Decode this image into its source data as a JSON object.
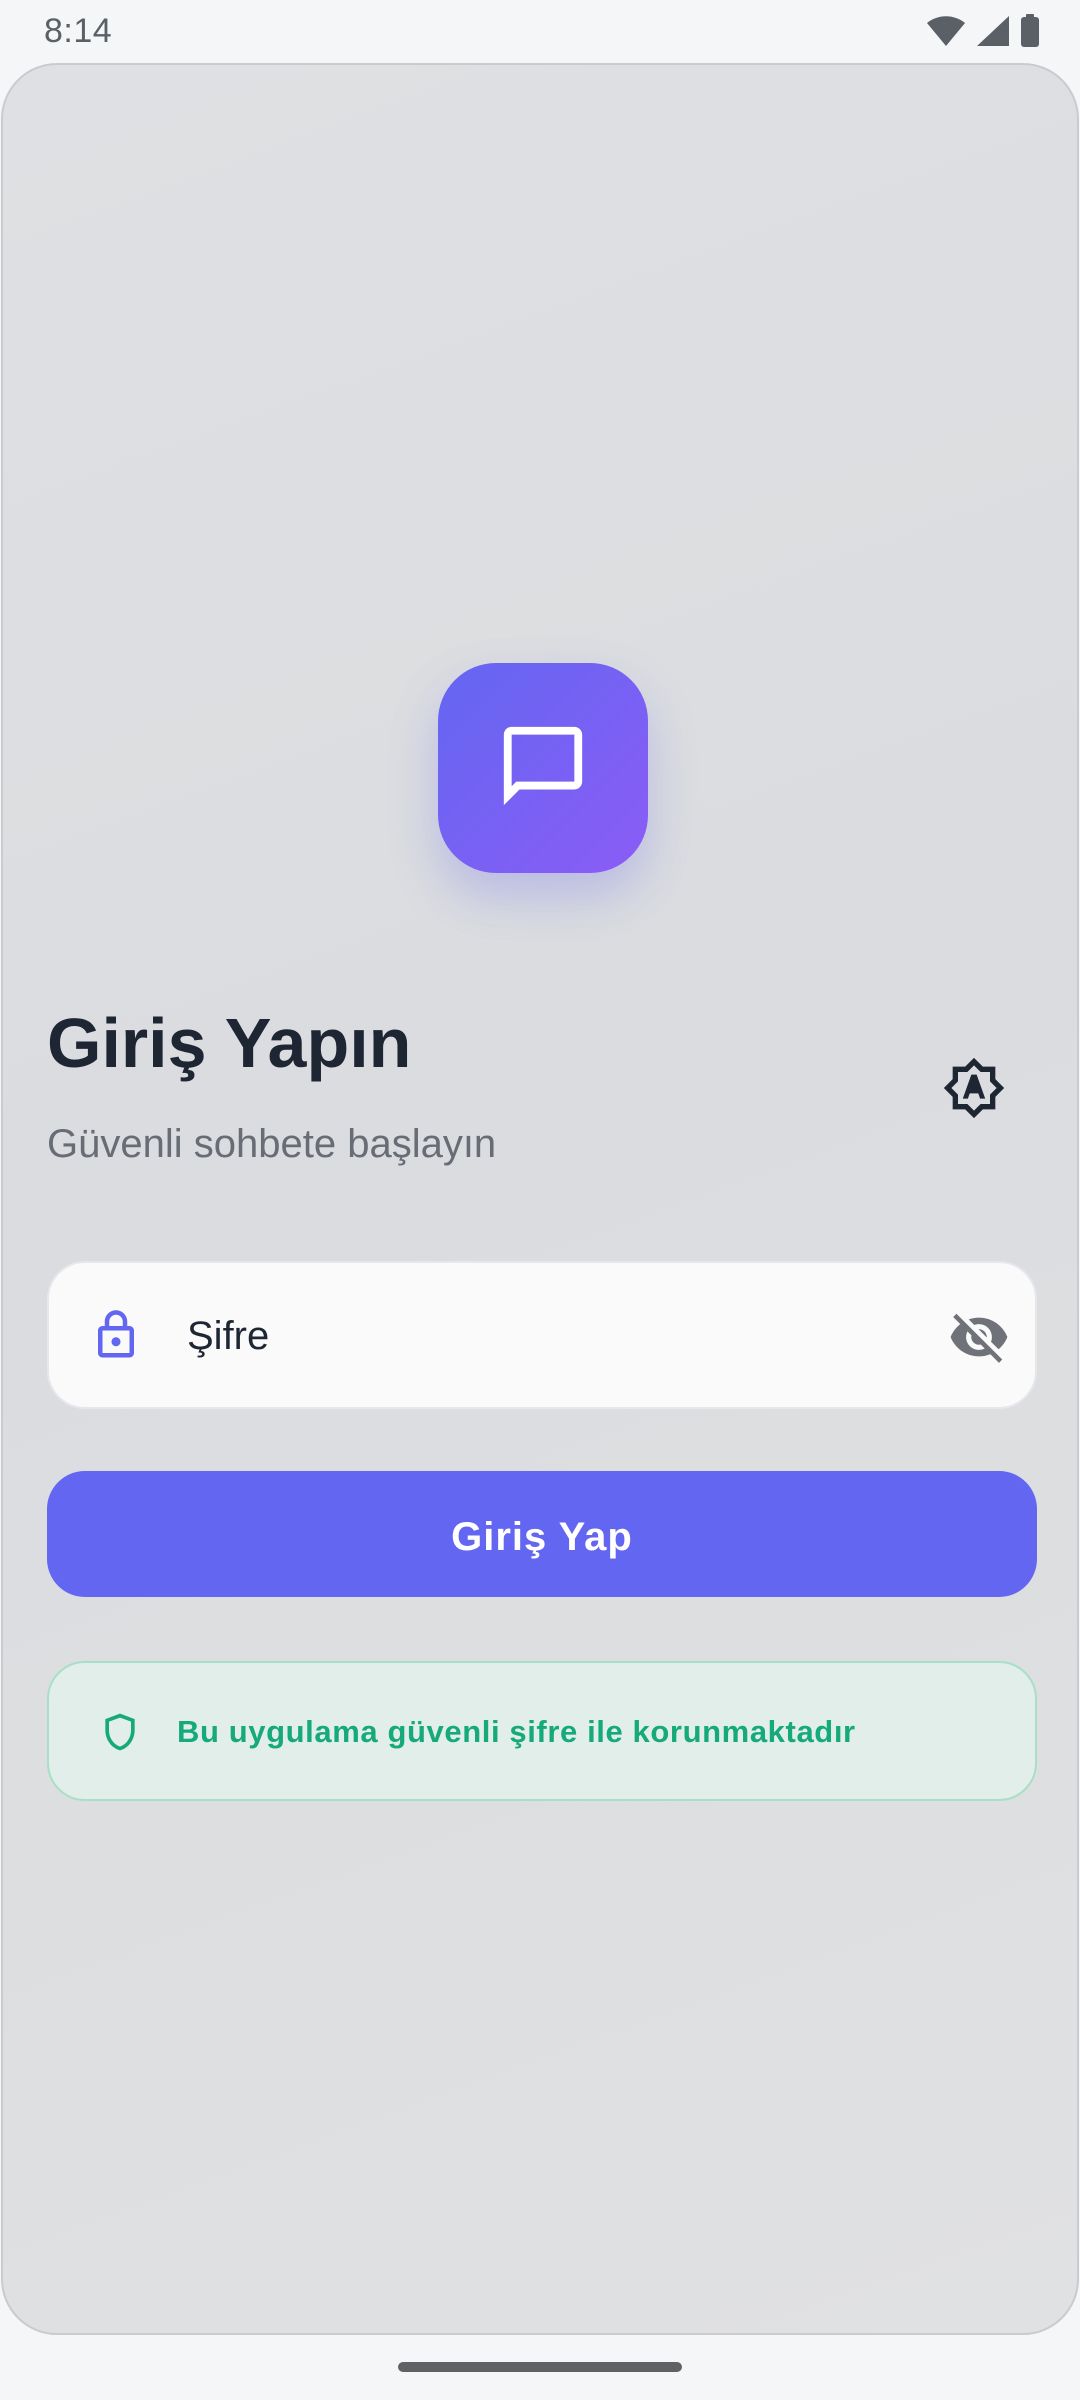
{
  "status_bar": {
    "time": "8:14",
    "icons": [
      "wifi-icon",
      "signal-icon",
      "battery-icon"
    ]
  },
  "app_logo": {
    "icon": "chat-bubble-icon",
    "gradient_start": "#6366f1",
    "gradient_end": "#8b5cf6"
  },
  "header": {
    "title": "Giriş Yapın",
    "subtitle": "Güvenli sohbete başlayın",
    "theme_toggle_icon": "brightness-auto-icon"
  },
  "password_field": {
    "placeholder": "Şifre",
    "value": "",
    "leading_icon": "lock-icon",
    "trailing_icon": "visibility-off-icon"
  },
  "login_button": {
    "label": "Giriş Yap"
  },
  "security_notice": {
    "icon": "shield-icon",
    "text": "Bu uygulama güvenli şifre ile korunmaktadır"
  },
  "colors": {
    "accent": "#6366f1",
    "accent_purple": "#8b5cf6",
    "title_text": "#1e2533",
    "subtitle_text": "#686c74",
    "success_text": "#16a97a",
    "success_bg": "#e2eee9",
    "success_border": "#a8dfc6"
  }
}
